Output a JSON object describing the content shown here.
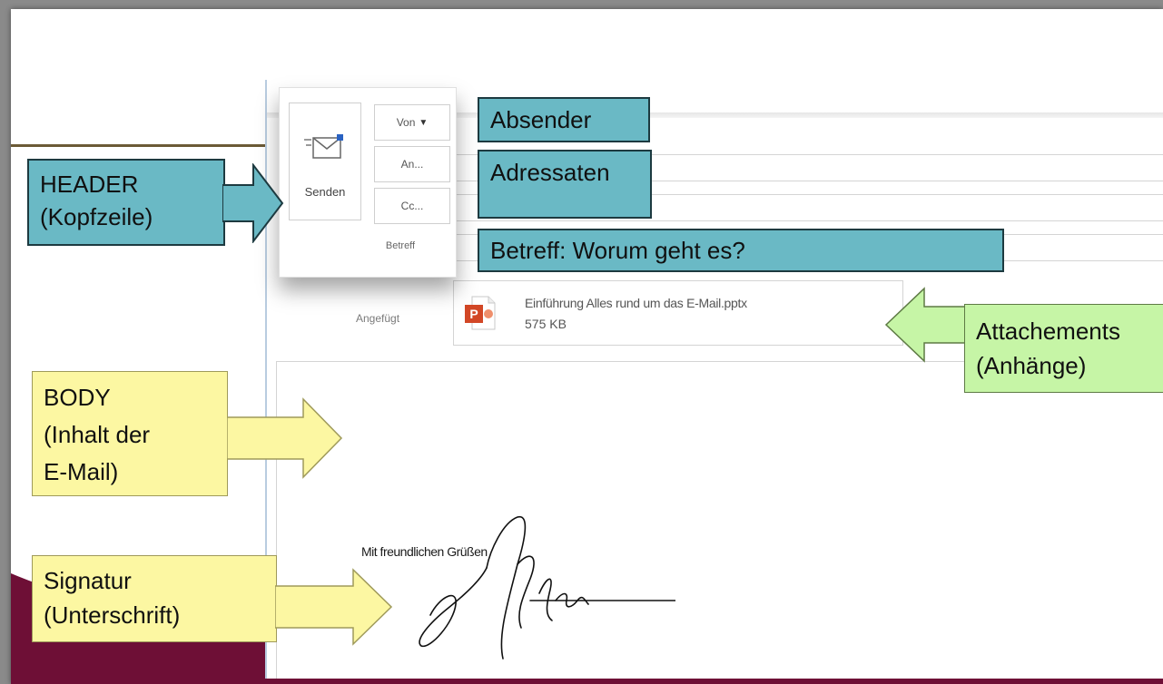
{
  "compose": {
    "attachment": {
      "label": "Angefügt",
      "file_name": "Einführung Alles rund um das E-Mail.pptx",
      "file_size": "575 KB",
      "icon": "powerpoint-file-icon"
    },
    "body": {
      "greeting": "Mit freundlichen Grüßen",
      "signature_icon": "handwritten-signature"
    },
    "send_panel": {
      "send_label": "Senden",
      "from_label": "Von",
      "to_label": "An...",
      "cc_label": "Cc...",
      "subject_label": "Betreff"
    }
  },
  "annotations": {
    "header": [
      "HEADER",
      "(Kopfzeile)"
    ],
    "sender": "Absender",
    "recipients": "Adressaten",
    "subject": "Betreff: Worum geht es?",
    "attachments": [
      "Attachements",
      "(Anhänge)"
    ],
    "body": [
      "BODY",
      "(Inhalt der",
      "E-Mail)"
    ],
    "signature": [
      "Signatur",
      "(Unterschrift)"
    ]
  },
  "colors": {
    "teal_label": "#6ab9c5",
    "yellow_label": "#fcf7a2",
    "green_label": "#c6f5a6",
    "maroon_wave": "#6e0f36"
  }
}
